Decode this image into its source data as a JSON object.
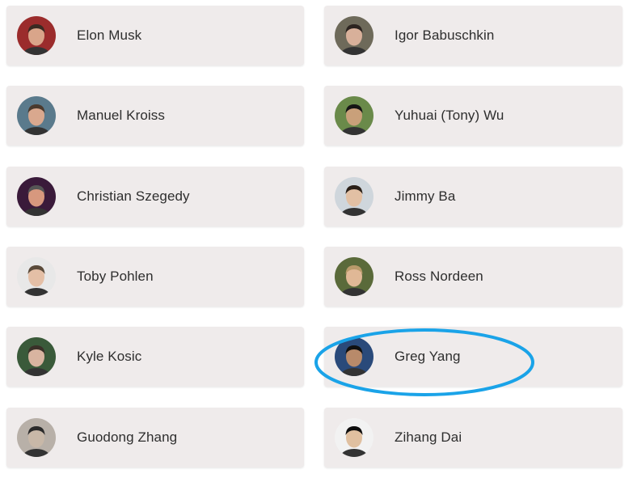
{
  "members": [
    {
      "name": "Elon Musk",
      "avatar": "elon-musk-avatar",
      "skin": "#d9a58a",
      "hair": "#3a2a22",
      "bg": "#9b2c2c"
    },
    {
      "name": "Igor Babuschkin",
      "avatar": "igor-babuschkin-avatar",
      "skin": "#d8b09a",
      "hair": "#2c2420",
      "bg": "#6e6a5a"
    },
    {
      "name": "Manuel Kroiss",
      "avatar": "manuel-kroiss-avatar",
      "skin": "#d9a88e",
      "hair": "#4a3a2e",
      "bg": "#5a7a8c"
    },
    {
      "name": "Yuhuai (Tony) Wu",
      "avatar": "yuhuai-tony-wu-avatar",
      "skin": "#c9a07a",
      "hair": "#151515",
      "bg": "#6a8a4a"
    },
    {
      "name": "Christian Szegedy",
      "avatar": "christian-szegedy-avatar",
      "skin": "#d7987e",
      "hair": "#555555",
      "bg": "#3a1a3a"
    },
    {
      "name": "Jimmy Ba",
      "avatar": "jimmy-ba-avatar",
      "skin": "#e2c0a4",
      "hair": "#2a2018",
      "bg": "#cfd6dc"
    },
    {
      "name": "Toby Pohlen",
      "avatar": "toby-pohlen-avatar",
      "skin": "#e4bfa6",
      "hair": "#5a4a3a",
      "bg": "#e8e8e8"
    },
    {
      "name": "Ross Nordeen",
      "avatar": "ross-nordeen-avatar",
      "skin": "#e0b896",
      "hair": "#b89a6a",
      "bg": "#5a6a3a"
    },
    {
      "name": "Kyle Kosic",
      "avatar": "kyle-kosic-avatar",
      "skin": "#d8b4a0",
      "hair": "#3a3028",
      "bg": "#3a5a3a"
    },
    {
      "name": "Greg Yang",
      "avatar": "greg-yang-avatar",
      "skin": "#b88a6a",
      "hair": "#101010",
      "bg": "#2a4a7a"
    },
    {
      "name": "Guodong Zhang",
      "avatar": "guodong-zhang-avatar",
      "skin": "#c8b8a8",
      "hair": "#2a2a2a",
      "bg": "#b8b0a8"
    },
    {
      "name": "Zihang Dai",
      "avatar": "zihang-dai-avatar",
      "skin": "#e0c0a0",
      "hair": "#0e0e0e",
      "bg": "#f2f2f2"
    }
  ],
  "highlight": {
    "target": "Greg Yang",
    "color": "#1aa3e8"
  }
}
